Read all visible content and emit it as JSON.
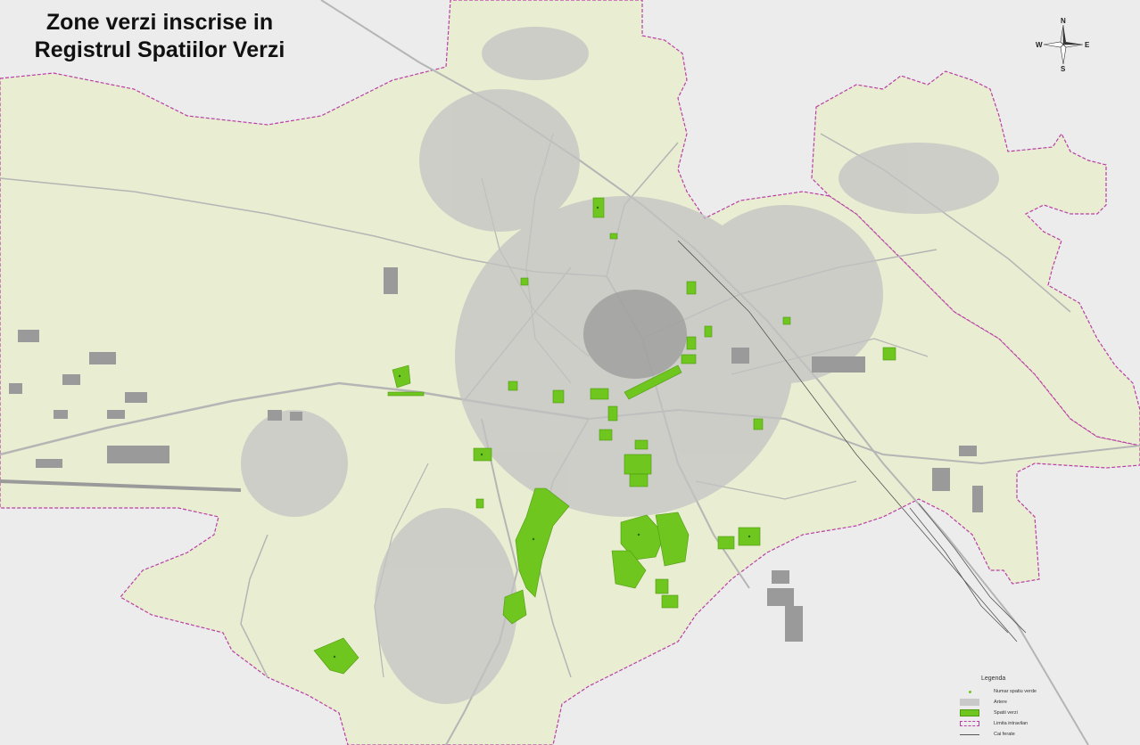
{
  "title": {
    "line1": "Zone verzi inscrise in",
    "line2": "Registrul Spatiilor Verzi"
  },
  "compass": {
    "n": "N",
    "s": "S",
    "e": "E",
    "w": "W"
  },
  "legend": {
    "title": "Legenda",
    "items": [
      {
        "symbol": "dot",
        "label": "Numar spatiu verde"
      },
      {
        "symbol": "artere",
        "label": "Artere"
      },
      {
        "symbol": "spatii-verzi",
        "label": "Spatii verzi"
      },
      {
        "symbol": "limita",
        "label": "Limita intravilan"
      },
      {
        "symbol": "cai-ferate",
        "label": "Cai ferate"
      }
    ]
  },
  "colors": {
    "background": "#ececec",
    "intravilan": "#e9edd1",
    "boundary": "#b93fa6",
    "roads": "#b5b5b5",
    "buildings": "#9a9a9a",
    "green": "#6ec61e",
    "green_border": "#4f9a12",
    "railway": "#555555"
  }
}
